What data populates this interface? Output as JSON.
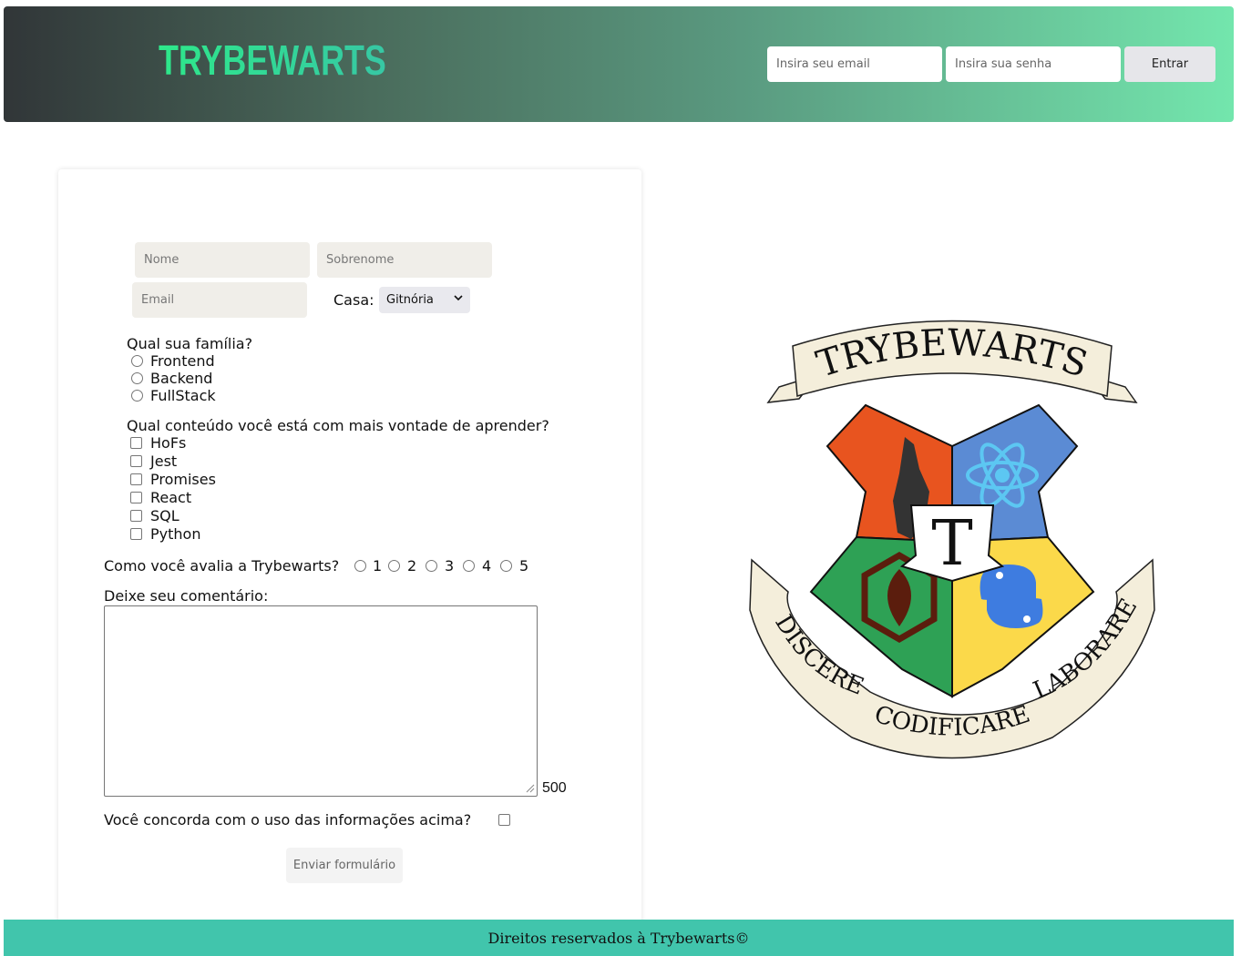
{
  "header": {
    "logo_text": "TRYBEWARTS",
    "email_placeholder": "Insira seu email",
    "password_placeholder": "Insira sua senha",
    "login_button": "Entrar"
  },
  "form": {
    "name_placeholder": "Nome",
    "lastname_placeholder": "Sobrenome",
    "email_placeholder": "Email",
    "house_label": "Casa:",
    "house_selected": "Gitnória",
    "family_question": "Qual sua família?",
    "families": [
      "Frontend",
      "Backend",
      "FullStack"
    ],
    "content_question": "Qual conteúdo você está com mais vontade de aprender?",
    "contents": [
      "HoFs",
      "Jest",
      "Promises",
      "React",
      "SQL",
      "Python"
    ],
    "rating_question": "Como você avalia a Trybewarts?",
    "ratings": [
      "1",
      "2",
      "3",
      "4",
      "5"
    ],
    "comment_label": "Deixe seu comentário:",
    "char_counter": "500",
    "agreement_label": "Você concorda com o uso das informações acima?",
    "submit_button": "Enviar formulário"
  },
  "crest": {
    "banner_top": "TRYBEWARTS",
    "banner_left": "DISCERE",
    "banner_bottom": "CODIFICARE",
    "banner_right": "LABORARE",
    "center_letter": "T",
    "quadrant_colors": [
      "#e8541f",
      "#5b8bd4",
      "#2ea155",
      "#fbd94a"
    ]
  },
  "footer": {
    "text": "Direitos reservados à Trybewarts©"
  }
}
